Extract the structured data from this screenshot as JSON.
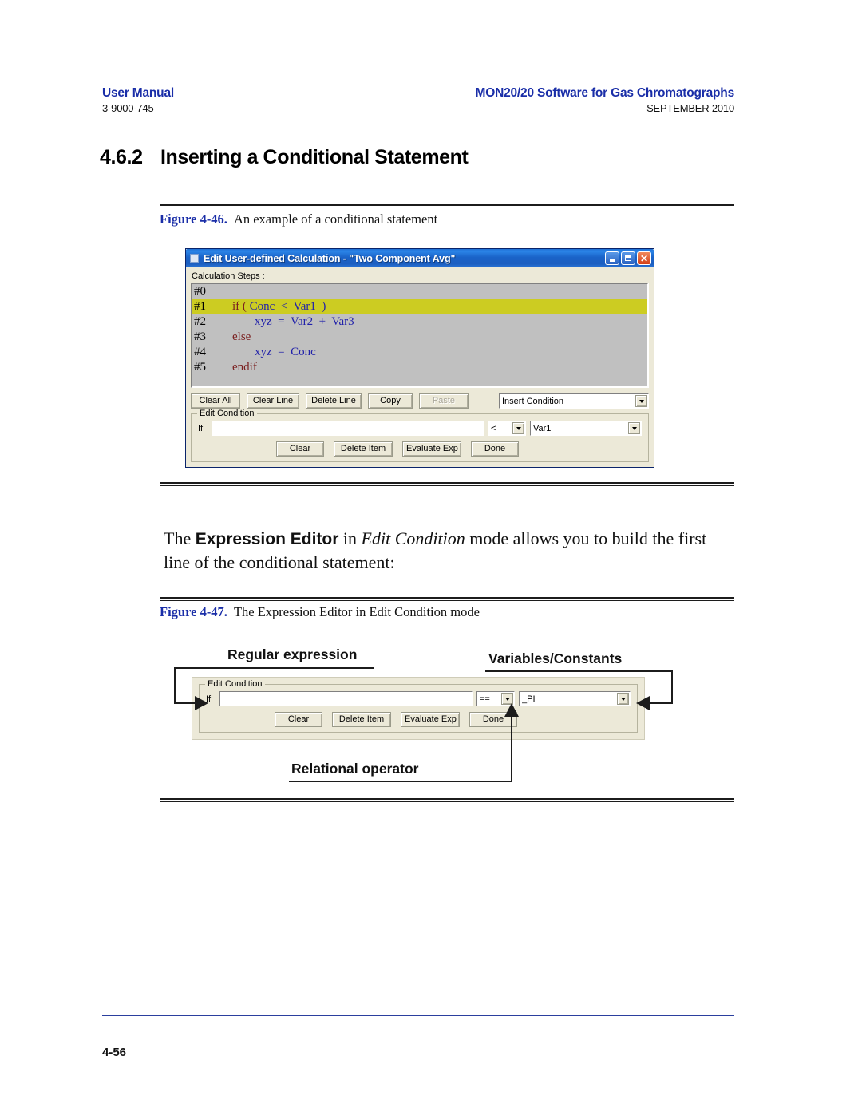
{
  "header": {
    "left_main": "User Manual",
    "left_sub": "3-9000-745",
    "right_main": "MON20/20 Software for Gas Chromatographs",
    "right_sub": "SEPTEMBER 2010",
    "rule_color": "#2b3f9e"
  },
  "section": {
    "number": "4.6.2",
    "title": "Inserting a Conditional Statement"
  },
  "figure46": {
    "caption_label": "Figure 4-46.",
    "caption_text": "An example of a conditional statement",
    "dialog": {
      "title": "Edit User-defined Calculation - \"Two Component Avg\"",
      "title_icon": "window-icon",
      "buttons": {
        "minimize": "minimize-icon",
        "maximize": "maximize-icon",
        "close": "close-icon"
      },
      "steps_label": "Calculation Steps :",
      "code_lines": [
        {
          "num": "#0",
          "indent": 0,
          "keyword": "",
          "expression": "",
          "selected": false
        },
        {
          "num": "#1",
          "indent": 1,
          "keyword": "if (",
          "expression": " Conc  <  Var1  )",
          "selected": true
        },
        {
          "num": "#2",
          "indent": 3,
          "keyword": "",
          "expression": "xyz  =  Var2  +  Var3",
          "selected": false
        },
        {
          "num": "#3",
          "indent": 1,
          "keyword": "else",
          "expression": "",
          "selected": false
        },
        {
          "num": "#4",
          "indent": 3,
          "keyword": "",
          "expression": "xyz  =  Conc",
          "selected": false
        },
        {
          "num": "#5",
          "indent": 1,
          "keyword": "endif",
          "expression": "",
          "selected": false
        }
      ],
      "toolbar": [
        {
          "label": "Clear All",
          "disabled": false
        },
        {
          "label": "Clear Line",
          "disabled": false
        },
        {
          "label": "Delete Line",
          "disabled": false
        },
        {
          "label": "Copy",
          "disabled": false
        },
        {
          "label": "Paste",
          "disabled": true
        }
      ],
      "insert_combo_value": "Insert Condition",
      "edit_condition": {
        "legend": "Edit Condition",
        "if_label": "If",
        "expression_value": "",
        "operator_value": "<",
        "variable_value": "Var1",
        "buttons": [
          "Clear",
          "Delete Item",
          "Evaluate Exp",
          "Done"
        ]
      },
      "colors": {
        "titlebar": "#1c5ec0",
        "dialog_face": "#ece9d8",
        "listbox": "#c0c0c0",
        "selection": "#cccc22",
        "keyword": "#7a2020",
        "expression": "#2222aa"
      }
    }
  },
  "body_paragraph": {
    "part1": "The ",
    "bold1": "Expression Editor",
    "part2": " in ",
    "italic1": "Edit Condition",
    "part3": " mode allows you to build the first line of the conditional statement:"
  },
  "figure47": {
    "caption_label": "Figure 4-47.",
    "caption_text": "The Expression Editor in Edit Condition mode",
    "annotations": [
      {
        "label": "Regular expression",
        "target": "expression-input"
      },
      {
        "label": "Variables/Constants",
        "target": "variable-combo"
      },
      {
        "label": "Relational operator",
        "target": "operator-combo"
      }
    ],
    "panel": {
      "legend": "Edit Condition",
      "if_label": "If",
      "expression_value": "",
      "operator_value": "==",
      "variable_value": "_PI",
      "buttons": [
        "Clear",
        "Delete Item",
        "Evaluate Exp",
        "Done"
      ]
    }
  },
  "footer": {
    "page_number": "4-56"
  }
}
